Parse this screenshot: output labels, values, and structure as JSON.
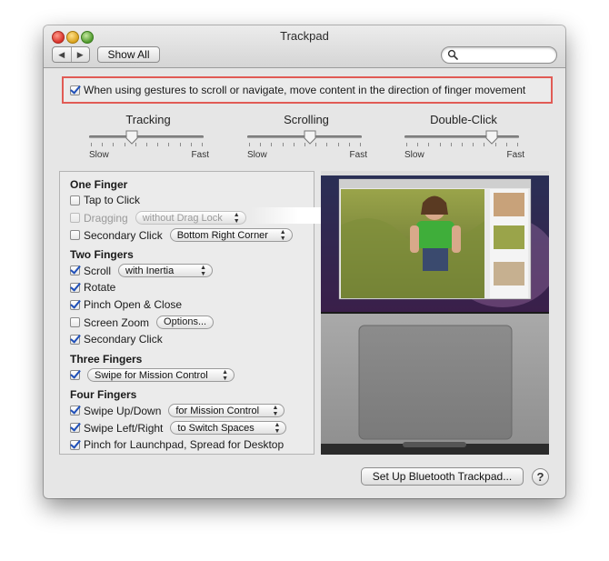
{
  "window": {
    "title": "Trackpad",
    "show_all": "Show All",
    "back_arrow": "◀",
    "forward_arrow": "▶",
    "search_placeholder": ""
  },
  "direction_option": {
    "checked": true,
    "label": "When using gestures to scroll or navigate, move content in the direction of finger movement"
  },
  "sliders": [
    {
      "label": "Tracking",
      "min_label": "Slow",
      "max_label": "Fast",
      "value": 0.37
    },
    {
      "label": "Scrolling",
      "min_label": "Slow",
      "max_label": "Fast",
      "value": 0.55
    },
    {
      "label": "Double-Click",
      "min_label": "Slow",
      "max_label": "Fast",
      "value": 0.76
    }
  ],
  "one_finger": {
    "heading": "One Finger",
    "tap_to_click": {
      "label": "Tap to Click",
      "checked": false
    },
    "dragging": {
      "label": "Dragging",
      "checked": false,
      "enabled": false,
      "option": "without Drag Lock"
    },
    "secondary_click": {
      "label": "Secondary Click",
      "checked": false,
      "option": "Bottom Right Corner"
    }
  },
  "two_fingers": {
    "heading": "Two Fingers",
    "scroll": {
      "label": "Scroll",
      "checked": true,
      "option": "with Inertia"
    },
    "rotate": {
      "label": "Rotate",
      "checked": true
    },
    "pinch": {
      "label": "Pinch Open & Close",
      "checked": true
    },
    "screen_zoom": {
      "label": "Screen Zoom",
      "checked": false,
      "button": "Options..."
    },
    "secondary_click": {
      "label": "Secondary Click",
      "checked": true
    }
  },
  "three_fingers": {
    "heading": "Three Fingers",
    "swipe": {
      "checked": true,
      "option": "Swipe for Mission Control"
    }
  },
  "four_fingers": {
    "heading": "Four Fingers",
    "swipe_up_down": {
      "label": "Swipe Up/Down",
      "checked": true,
      "option": "for Mission Control"
    },
    "swipe_left_right": {
      "label": "Swipe Left/Right",
      "checked": true,
      "option": "to Switch Spaces"
    },
    "pinch_launchpad": {
      "label": "Pinch for Launchpad, Spread for Desktop",
      "checked": true
    }
  },
  "footer": {
    "setup_button": "Set Up Bluetooth Trackpad...",
    "help_button": "?"
  }
}
